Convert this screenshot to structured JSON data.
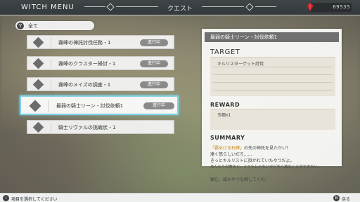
{
  "app": {
    "title": "WITCH MENU",
    "screen_title": "クエスト"
  },
  "header": {
    "currency_value": "69535",
    "currency_icon": "red-gem-icon"
  },
  "filter": {
    "button": "Y",
    "label": "全て"
  },
  "quests": [
    {
      "name": "霧峰の神託討伐任務・1",
      "status": "進行中",
      "selected": false
    },
    {
      "name": "霧峰のクラスター掃討・1",
      "status": "進行中",
      "selected": false
    },
    {
      "name": "霧峰のメイズの調査・1",
      "status": "進行中",
      "selected": false
    },
    {
      "name": "最弱の騎士リーン・討伐依頼1",
      "status": "進行中",
      "selected": true
    },
    {
      "name": "騎士リヴァルの挑戦状・1",
      "status": "",
      "selected": false
    }
  ],
  "detail": {
    "title": "最弱の騎士リーン・討伐依頼1",
    "target_label": "TARGET",
    "target_text": "キルリスターゲット討伐",
    "reward_label": "REWARD",
    "reward_text": "玉鋼x1",
    "summary_label": "SUMMARY",
    "summary_highlight": "「霧めける石碑」",
    "summary_line1_rest": "の先の神託を見たかい？",
    "summary_line2": "凄く怒らしいだろ……",
    "summary_line3": "きっとキルリストに掛かれていたやつだよ。",
    "summary_line4": "あんならが寄ると、とてもじゃないけど先へ進むことができない。",
    "summary_line5": "頼む、誰かやつを倒してくれ！"
  },
  "footer": {
    "hint": "項目を選択してください",
    "back_button": "B",
    "back_label": "戻る"
  },
  "colors": {
    "selection": "#7fd3e6",
    "header": "#3f4447",
    "status_pill": "#8a8a8a",
    "highlight": "#c8860e"
  }
}
